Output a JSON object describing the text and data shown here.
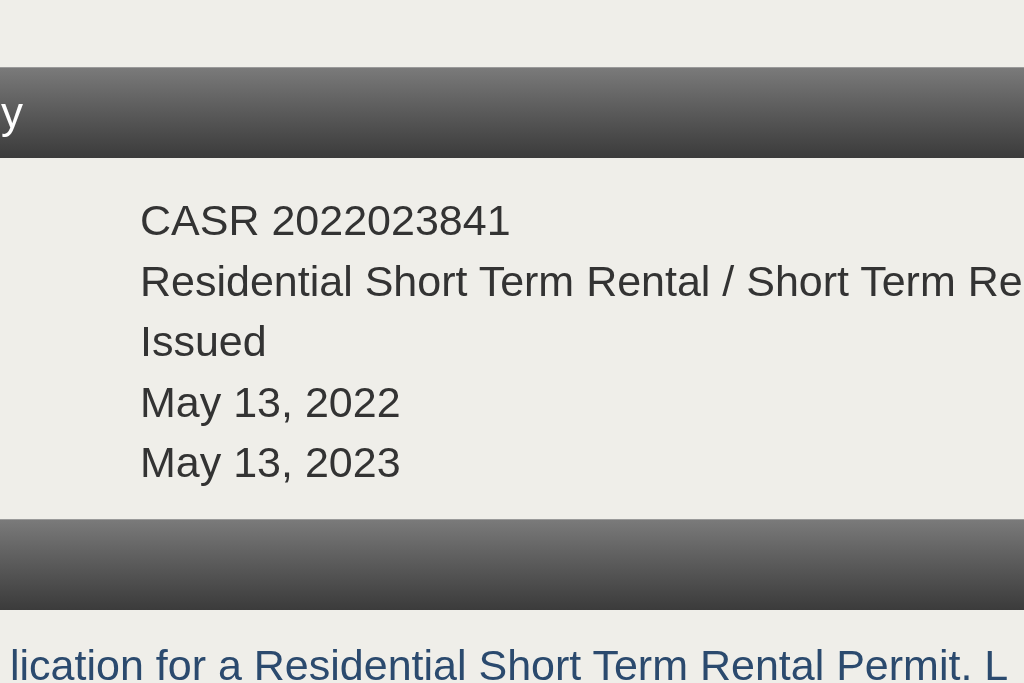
{
  "sections": [
    {
      "header": "y",
      "fields": [
        "CASR 2022023841",
        "Residential Short Term Rental / Short Term Re",
        "Issued",
        "May 13, 2022",
        "May 13, 2023"
      ]
    },
    {
      "link": "lication for a Residential Short Term Rental Permit. L"
    }
  ]
}
